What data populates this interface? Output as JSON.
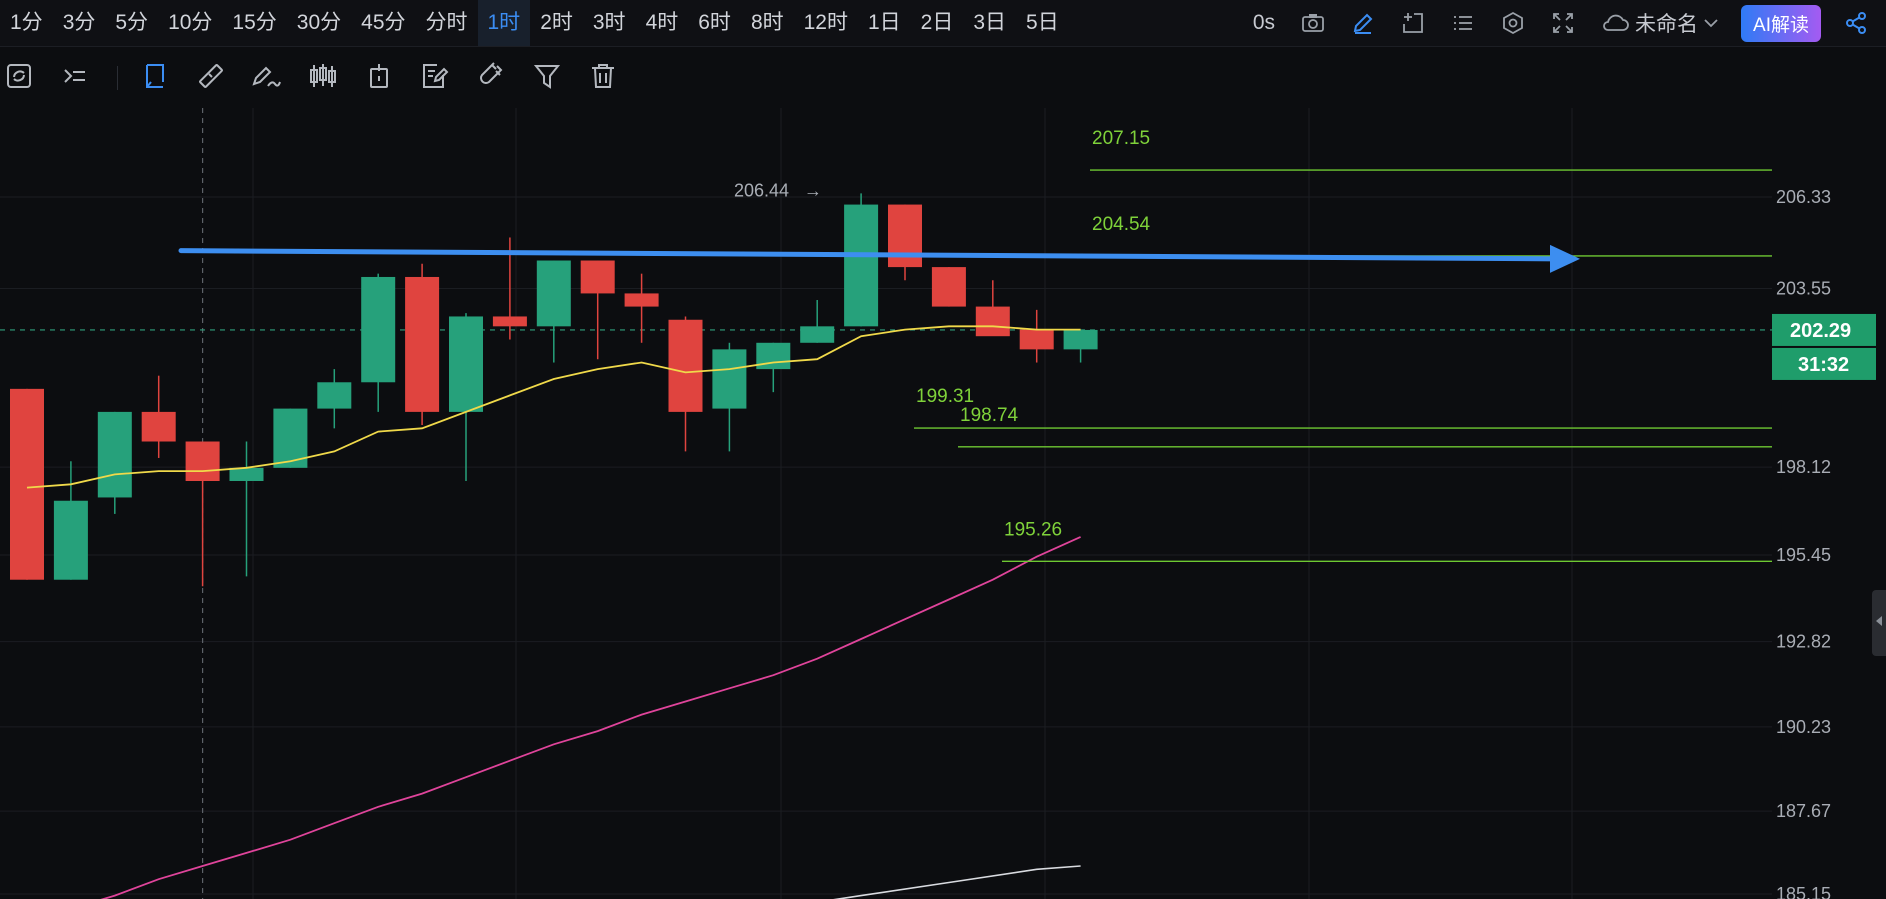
{
  "top_bar": {
    "intervals": [
      "1分",
      "3分",
      "5分",
      "10分",
      "15分",
      "30分",
      "45分",
      "分时",
      "1时",
      "2时",
      "3时",
      "4时",
      "6时",
      "8时",
      "12时",
      "1日",
      "2日",
      "3日",
      "5日"
    ],
    "active_interval": "1时",
    "timer": "0s",
    "layout_name": "未命名",
    "ai_button": "AI解读",
    "icons": [
      "camera-icon",
      "pencil-icon",
      "add-window-icon",
      "list-icon",
      "settings-icon",
      "fullscreen-icon",
      "cloud-icon",
      "chevron-down-icon",
      "share-icon"
    ]
  },
  "drawing_toolbar": {
    "icons": [
      "sync-icon",
      "cursor-crosshair-icon",
      "select-icon",
      "ruler-icon",
      "brush-icon",
      "candles-icon",
      "tag-icon",
      "note-edit-icon",
      "magnet-icon",
      "filter-icon",
      "trash-icon"
    ],
    "active": "select-icon"
  },
  "colors": {
    "up": "#26a17b",
    "down": "#e0443f",
    "ma_short": "#f0d94a",
    "ma_mid": "#e0449b",
    "ma_long": "#d9dbe0",
    "level_line": "#6ec832",
    "trend_arrow": "#3d8ef0",
    "price_tag": "#1f9d6b",
    "background": "#0c0d10",
    "accent": "#3b8df3"
  },
  "chart_data": {
    "type": "candlestick",
    "y_axis_ticks": [
      "206.33",
      "203.55",
      "198.12",
      "195.45",
      "192.82",
      "190.23",
      "187.67",
      "185.15"
    ],
    "y_tick_values": [
      206.33,
      203.55,
      198.12,
      195.45,
      192.82,
      190.23,
      187.67,
      185.15
    ],
    "current_price": "202.29",
    "countdown": "31:32",
    "high_marker": "206.44",
    "levels": [
      {
        "label": "207.15",
        "value": 207.15
      },
      {
        "label": "204.54",
        "value": 204.54
      },
      {
        "label": "199.31",
        "value": 199.31
      },
      {
        "label": "198.74",
        "value": 198.74
      },
      {
        "label": "195.26",
        "value": 195.26
      }
    ],
    "trend_line": {
      "from": 204.7,
      "to": 204.45
    },
    "candles": [
      {
        "o": 200.5,
        "h": 200.5,
        "l": 194.7,
        "c": 194.7
      },
      {
        "o": 194.7,
        "h": 198.3,
        "l": 194.7,
        "c": 197.1
      },
      {
        "o": 197.2,
        "h": 199.8,
        "l": 196.7,
        "c": 199.8
      },
      {
        "o": 199.8,
        "h": 200.9,
        "l": 198.4,
        "c": 198.9
      },
      {
        "o": 198.9,
        "h": 198.9,
        "l": 194.5,
        "c": 197.7
      },
      {
        "o": 197.7,
        "h": 198.9,
        "l": 194.8,
        "c": 198.1
      },
      {
        "o": 198.1,
        "h": 199.9,
        "l": 198.1,
        "c": 199.9
      },
      {
        "o": 199.9,
        "h": 201.1,
        "l": 199.3,
        "c": 200.7
      },
      {
        "o": 200.7,
        "h": 204.0,
        "l": 199.8,
        "c": 203.9
      },
      {
        "o": 203.9,
        "h": 204.3,
        "l": 199.4,
        "c": 199.8
      },
      {
        "o": 199.8,
        "h": 202.8,
        "l": 197.7,
        "c": 202.7
      },
      {
        "o": 202.7,
        "h": 205.1,
        "l": 202.0,
        "c": 202.4
      },
      {
        "o": 202.4,
        "h": 204.4,
        "l": 201.3,
        "c": 204.4
      },
      {
        "o": 204.4,
        "h": 204.4,
        "l": 201.4,
        "c": 203.4
      },
      {
        "o": 203.4,
        "h": 204.0,
        "l": 201.9,
        "c": 203.0
      },
      {
        "o": 202.6,
        "h": 202.7,
        "l": 198.6,
        "c": 199.8
      },
      {
        "o": 199.9,
        "h": 201.9,
        "l": 198.6,
        "c": 201.7
      },
      {
        "o": 201.1,
        "h": 201.9,
        "l": 200.4,
        "c": 201.9
      },
      {
        "o": 201.9,
        "h": 203.2,
        "l": 201.9,
        "c": 202.4
      },
      {
        "o": 202.4,
        "h": 206.44,
        "l": 202.4,
        "c": 206.1
      },
      {
        "o": 206.1,
        "h": 206.1,
        "l": 203.8,
        "c": 204.2
      },
      {
        "o": 204.2,
        "h": 204.2,
        "l": 203.0,
        "c": 203.0
      },
      {
        "o": 203.0,
        "h": 203.8,
        "l": 202.3,
        "c": 202.1
      },
      {
        "o": 202.3,
        "h": 202.9,
        "l": 201.3,
        "c": 201.7
      },
      {
        "o": 201.7,
        "h": 202.2,
        "l": 201.3,
        "c": 202.29
      }
    ],
    "ma_short": [
      197.5,
      197.6,
      197.9,
      198.0,
      198.0,
      198.1,
      198.3,
      198.6,
      199.2,
      199.3,
      199.8,
      200.3,
      200.8,
      201.1,
      201.3,
      201.0,
      201.1,
      201.3,
      201.4,
      202.1,
      202.3,
      202.4,
      202.4,
      202.3,
      202.3
    ],
    "ma_mid": [
      184.3,
      184.7,
      185.1,
      185.6,
      186.0,
      186.4,
      186.8,
      187.3,
      187.8,
      188.2,
      188.7,
      189.2,
      189.7,
      190.1,
      190.6,
      191.0,
      191.4,
      191.8,
      192.3,
      192.9,
      193.5,
      194.1,
      194.7,
      195.4,
      196.0
    ],
    "ma_long_segment": [
      {
        "i": 17,
        "v": 184.7
      },
      {
        "i": 19,
        "v": 185.1
      },
      {
        "i": 21,
        "v": 185.5
      },
      {
        "i": 23,
        "v": 185.9
      },
      {
        "i": 24,
        "v": 186.0
      }
    ],
    "crosshair_candle_index": 4
  }
}
